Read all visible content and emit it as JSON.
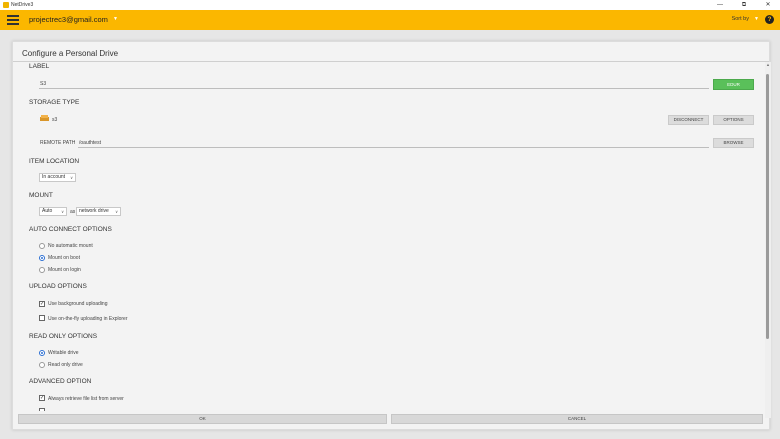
{
  "window": {
    "title": "NetDrive3",
    "controls": [
      "—",
      "⧉",
      "✕"
    ]
  },
  "topbar": {
    "account": "projectrec3@gmail.com",
    "sort_by": "Sort by"
  },
  "dialog": {
    "title": "Configure a Personal Drive",
    "label": {
      "heading": "LABEL",
      "value": "S3",
      "edit_button": "EDUR"
    },
    "storage_type": {
      "heading": "STORAGE TYPE",
      "type_name": "s3",
      "disconnect_button": "DISCONNECT",
      "options_button": "OPTIONS",
      "remote_path_label": "REMOTE PATH",
      "remote_path_value": "/oauthtest",
      "browse_button": "BROWSE"
    },
    "item_location": {
      "heading": "ITEM LOCATION",
      "selected": "In account"
    },
    "mount": {
      "heading": "MOUNT",
      "mode": "Auto",
      "as_label": "as",
      "type": "network drive"
    },
    "auto_connect": {
      "heading": "AUTO CONNECT OPTIONS",
      "options": [
        {
          "label": "No automatic mount",
          "checked": false
        },
        {
          "label": "Mount on boot",
          "checked": true
        },
        {
          "label": "Mount on login",
          "checked": false
        }
      ]
    },
    "upload": {
      "heading": "UPLOAD OPTIONS",
      "options": [
        {
          "label": "Use background uploading",
          "checked": true
        },
        {
          "label": "Use on-the-fly uploading in Explorer",
          "checked": false
        }
      ]
    },
    "read_only": {
      "heading": "READ ONLY OPTIONS",
      "options": [
        {
          "label": "Writable drive",
          "checked": true
        },
        {
          "label": "Read only drive",
          "checked": false
        }
      ]
    },
    "advanced": {
      "heading": "ADVANCED OPTION",
      "options": [
        {
          "label": "Always retrieve file list from server",
          "checked": true
        }
      ]
    },
    "footer": {
      "ok": "OK",
      "cancel": "CANCEL"
    }
  },
  "colors": {
    "accent": "#fbb700",
    "edit_green": "#5ac05a",
    "radio_blue": "#2c6fd3"
  }
}
